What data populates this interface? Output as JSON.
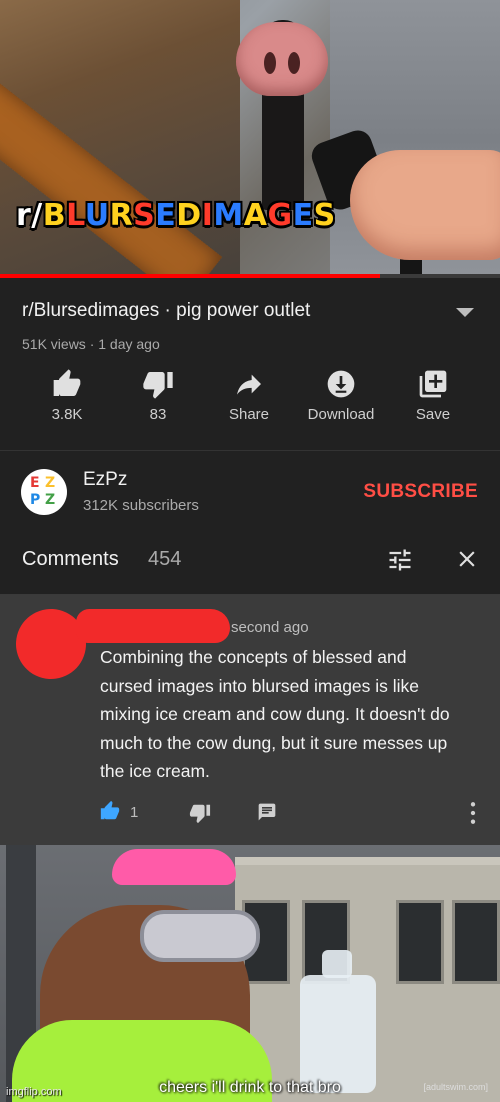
{
  "thumbnail": {
    "overlay_text": "r/BLURSEDIMAGES",
    "progress_fraction": 0.76
  },
  "video": {
    "title": "r/Blursedimages · pig power outlet",
    "meta": "51K views · 1 day ago",
    "actions": [
      {
        "icon": "thumb-up-icon",
        "label": "3.8K"
      },
      {
        "icon": "thumb-down-icon",
        "label": "83"
      },
      {
        "icon": "share-icon",
        "label": "Share"
      },
      {
        "icon": "download-icon",
        "label": "Download"
      },
      {
        "icon": "save-icon",
        "label": "Save"
      }
    ]
  },
  "channel": {
    "avatar_letters": [
      "E",
      "Z",
      "P",
      "Z"
    ],
    "name": "EzPz",
    "subscribers": "312K subscribers",
    "subscribe_label": "SUBSCRIBE"
  },
  "comments": {
    "title": "Comments",
    "count": "454",
    "items": [
      {
        "time": "second ago",
        "text": "Combining the concepts of blessed and cursed images into blursed images is like mixing ice cream and cow dung. It doesn't do much to the cow dung, but it sure messes up the ice cream.",
        "likes": "1"
      }
    ]
  },
  "meme": {
    "caption": "cheers i'll drink to that bro",
    "watermark": "imgflip.com",
    "corner_mark": "[adultswim.com]"
  },
  "colors": {
    "background": "#212121",
    "comment_bg": "#3b3b3b",
    "subscribe": "#ff4e45",
    "redaction": "#f22a2a",
    "like_active": "#3ea6ff"
  }
}
